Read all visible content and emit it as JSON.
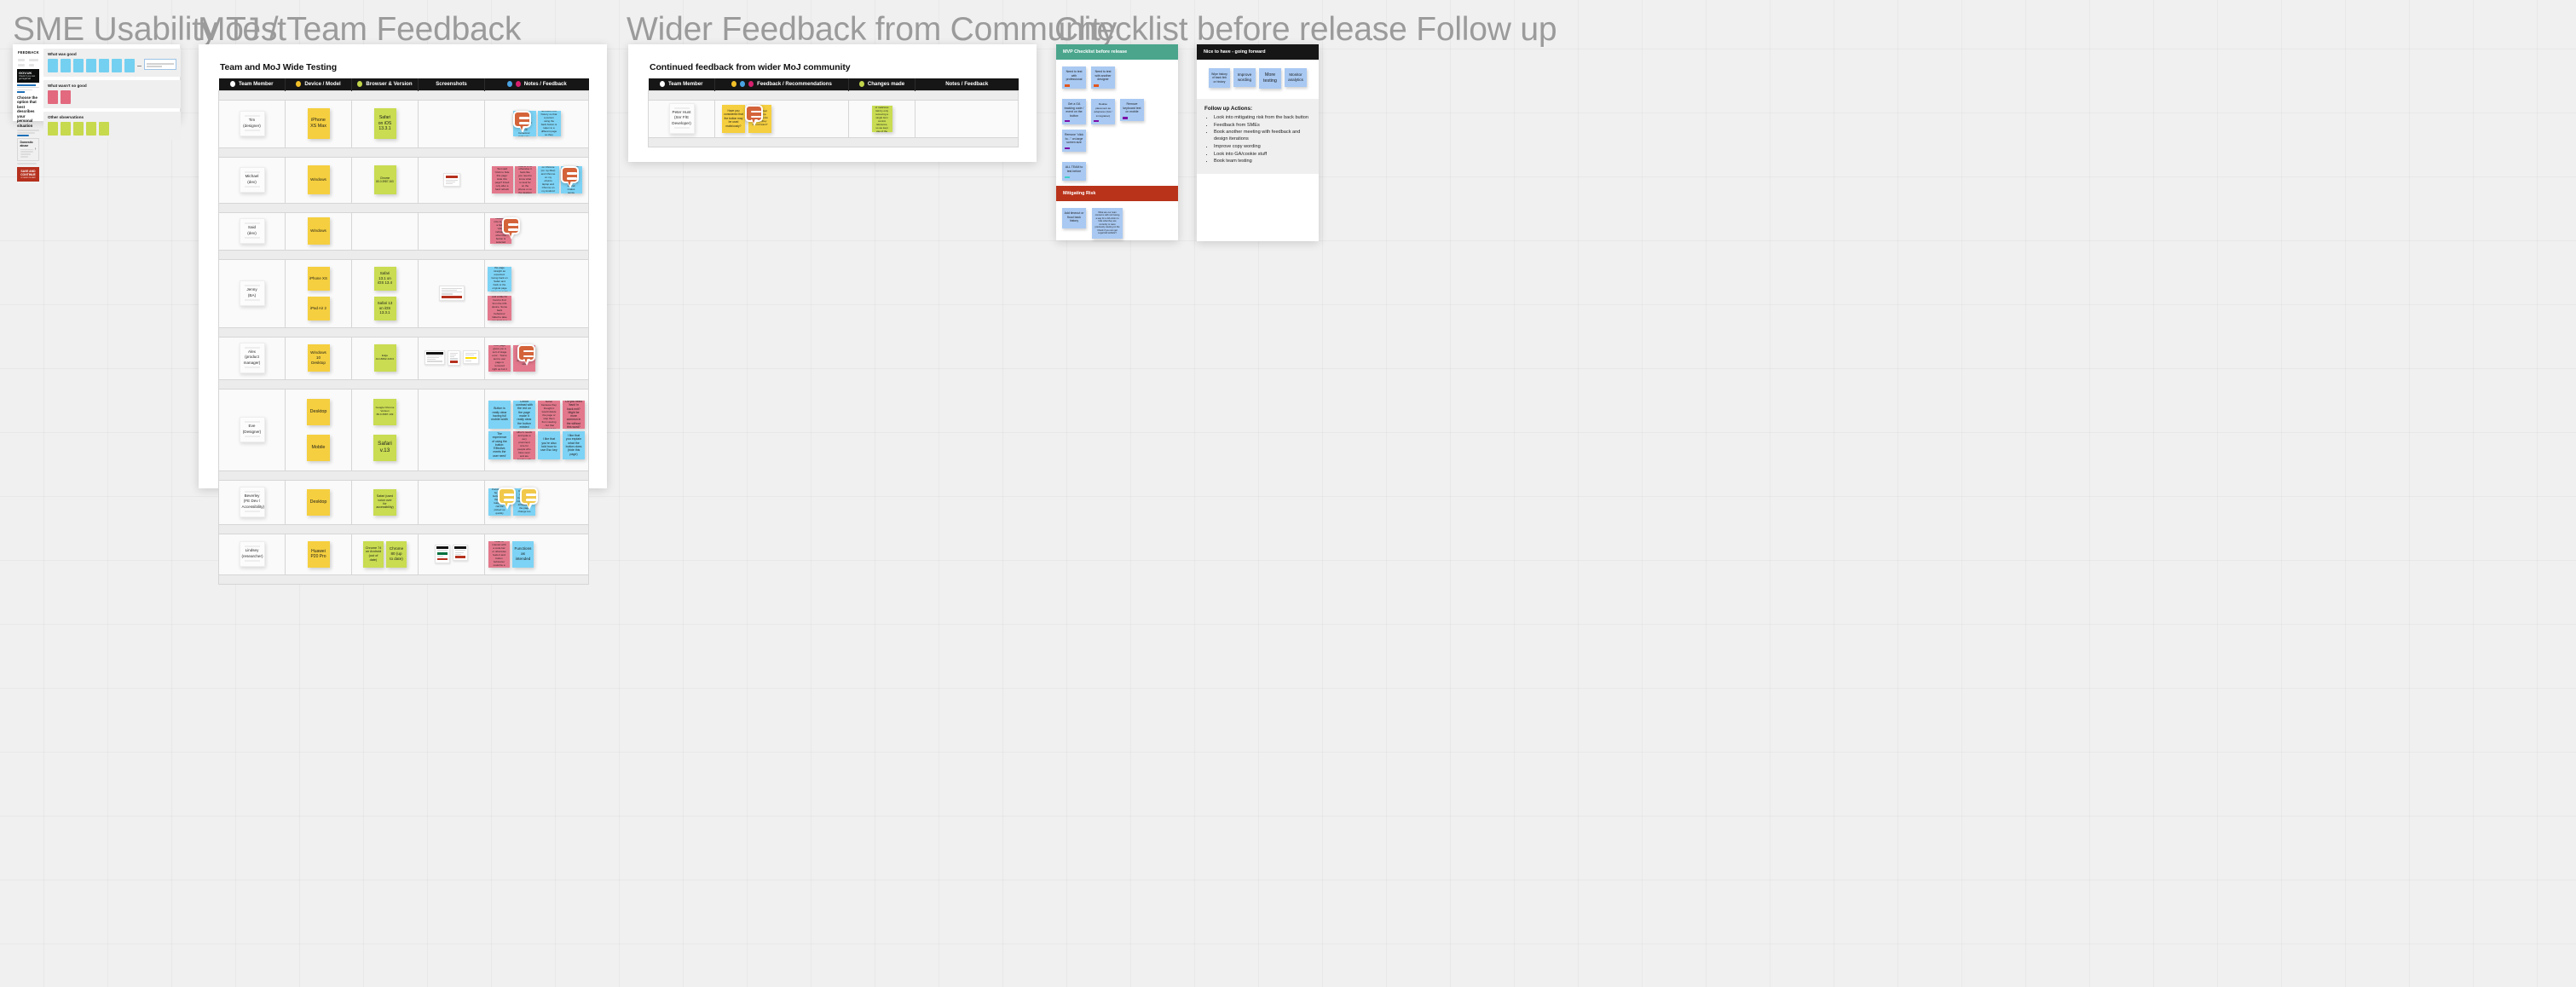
{
  "sections": [
    {
      "id": "sme",
      "title": "SME Usability Test"
    },
    {
      "id": "moj",
      "title": "MoJ / Team Feedback"
    },
    {
      "id": "wider",
      "title": "Wider Feedback from Community"
    },
    {
      "id": "checklist",
      "title": "Checklist before release Follow up"
    }
  ],
  "sme_card": {
    "gov": {
      "heading": "FEEDBACK",
      "brand": "GOV.UK",
      "brand_sub": "Check if you can get legal aid",
      "question": "Choose the option that best describes your personal situation",
      "box_title": "Domestic abuse",
      "button_label": "SAVE AND CONTINUE",
      "button_sub": "or return to start"
    },
    "groups": [
      {
        "label": "What was good",
        "color": "blue",
        "count": 7,
        "has_callout": true
      },
      {
        "label": "What wasn't so good",
        "color": "pink",
        "count": 2,
        "has_callout": false
      },
      {
        "label": "Other observations",
        "color": "lime",
        "count": 5,
        "has_callout": false
      }
    ]
  },
  "moj_card": {
    "title": "Team and MoJ Wide Testing",
    "columns": [
      {
        "label": "Team Member",
        "dots": [
          "white"
        ]
      },
      {
        "label": "Device / Model",
        "dots": [
          "amber"
        ]
      },
      {
        "label": "Browser & Version",
        "dots": [
          "lime"
        ]
      },
      {
        "label": "Screenshots",
        "dots": []
      },
      {
        "label": "Notes / Feedback",
        "dots": [
          "blue",
          "magenta"
        ]
      }
    ],
    "rows": [
      {
        "member": "Tim\n(designer)",
        "devices": [
          "iPhone\nXS Max"
        ],
        "device_size": "large",
        "browsers": [
          "Safari\non iOS\n13.3.1"
        ],
        "browser_size": "large",
        "screenshots": 0,
        "notes": [
          {
            "color": "blue",
            "text": "Interesting to hear the user was happy with the journey but unsure about the back button behaviour hiding the page"
          },
          {
            "color": "blue",
            "text": "Would be helpful if the page was being removed from history so that a person using the back button is taken to a different page so they cannot see what they were looking at"
          }
        ],
        "bubbles": 1
      },
      {
        "member": "Michael\n(dev)",
        "devices": [
          "Windows"
        ],
        "device_size": "medium",
        "browsers": [
          "Chrome\n80.0.3987.163"
        ],
        "browser_size": "small",
        "screenshots": 1,
        "notes": [
          {
            "color": "pink",
            "text": "Text said 'Click to hide this page' Hide this page? Fixed only after a hard refresh"
          },
          {
            "color": "pink",
            "text": "Not sure if users have worked out how to CTA otherwise it feels like you need to know what to look for on the phone or on the desktop in the companion too"
          },
          {
            "color": "blue",
            "text": "Worked fine on Chrome (on my Mac) and Chrome on my ubuntu laptop and Chrome on my Android phone"
          },
          {
            "color": "blue",
            "text": "Takes you to a different page but stops you from seeing the content so that makes sense"
          }
        ],
        "bubbles": 1
      },
      {
        "member": "Said\n(dev)",
        "devices": [
          "Windows"
        ],
        "device_size": "medium",
        "browsers": [],
        "browser_size": "medium",
        "screenshots": 0,
        "notes": [
          {
            "color": "pink",
            "text": "Would be nice to have a better visual indication when the button is selected"
          }
        ],
        "bubbles": 1
      },
      {
        "member": "Jenny\n(BA)",
        "devices": [
          "iPhone XS",
          "iPad Air 2"
        ],
        "device_size": "medium",
        "browsers": [
          "Safari\n13.1 on\niOS 13.4",
          "Safari 13\non iOS\n13.3.1"
        ],
        "browser_size": "medium",
        "screenshots": 1,
        "notes": [
          {
            "color": "blue",
            "text": "iPhone XS/Safari took the page straight as expected. Going back on Safari and back to the original page came up again - as expected"
          },
          {
            "color": "pink",
            "text": "iPad was loading slower and a little bit hard to find from the iOS device. Some back behaviour failed to take you back to a safer location"
          }
        ],
        "bubbles": 0
      },
      {
        "member": "Alex\n(product\nmanager)",
        "devices": [
          "Windows\n10\nDesktop"
        ],
        "device_size": "medium",
        "browsers": [
          "Edge\n44.18362.449.0"
        ],
        "browser_size": "small",
        "screenshots": 3,
        "notes": [
          {
            "color": "pink",
            "text": "Going back from page gives you a sort of stage error - 'Some text to use' page is removed right up but it redirects"
          },
          {
            "color": "pink",
            "text": "Would be great to test on the edge of the mobile size"
          }
        ],
        "bubbles": 1
      },
      {
        "member": "Eve\n(Designer)",
        "devices": [
          "Desktop",
          "Mobile"
        ],
        "device_size": "large",
        "browsers": [
          "Google Chrome\nVersion\n80.0.3987.149",
          "Safari\nv.13"
        ],
        "browser_size": "mixed",
        "screenshots": 0,
        "notes": [
          {
            "color": "blue",
            "text": "Button is really clear having full mobile width"
          },
          {
            "color": "blue",
            "text": "Colour contrast with the red on the page made it really clear the button existed"
          },
          {
            "color": "pink",
            "text": "Hesitation that users were afraid to hit the button because they thought it would delete the page or stop them from viewing - but that could just be me not being familiar with the dialogue"
          },
          {
            "color": "pink",
            "text": "Do you need 'back' in back exit? Might be more common in the without this word?"
          },
          {
            "color": "blue",
            "text": "The experience of using the button: 'Effective, meets the user need'"
          },
          {
            "color": "pink",
            "text": "In this case by needs of other's needs and quite a very prominent size for people who have seen and are familiar with the feature"
          },
          {
            "color": "blue",
            "text": "I like that you're also told how to use Esc key"
          },
          {
            "color": "blue",
            "text": "I like that you explain what the button does (hide this page)"
          }
        ],
        "bubbles": 0
      },
      {
        "member": "Beverley\n(FE Dev /\nAccessibility)",
        "devices": [
          "Desktop"
        ],
        "device_size": "large",
        "browsers": [
          "Safari (used\nvoice over\nfor\naccessibility)"
        ],
        "browser_size": "small",
        "screenshots": 0,
        "notes": [
          {
            "color": "blue",
            "text": "Focus should be on the button when the page loads so it can be picked up quickly"
          },
          {
            "color": "blue",
            "text": "Voice over read the button label correctly and announced the page change too"
          }
        ],
        "bubbles": 2,
        "bubble_color": "yellow"
      },
      {
        "member": "Lindsey\n(researcher)",
        "devices": [
          "Huawei\nP20 Pro"
        ],
        "device_size": "medium",
        "browsers": [
          "Chrome 74\non Android\n(out of\ndate)",
          "Chrome\n80 (up\nto date)"
        ],
        "browser_size": "mixed",
        "screenshots": 2,
        "notes": [
          {
            "color": "pink",
            "text": "Does still need to interact with a code bar or otherwise feels it and button behaviour could be a bit of a faff"
          },
          {
            "color": "blue",
            "text": "Functions as intended"
          }
        ],
        "bubbles": 0
      }
    ]
  },
  "wider_card": {
    "title": "Continued feedback from wider MoJ community",
    "columns": [
      {
        "label": "Team Member",
        "dots": [
          "white"
        ]
      },
      {
        "label": "Feedback / Recommendations",
        "dots": [
          "amber",
          "blue",
          "magenta"
        ]
      },
      {
        "label": "Changes made",
        "dots": [
          "lime"
        ]
      },
      {
        "label": "Notes / Feedback",
        "dots": []
      }
    ],
    "rows": [
      {
        "member": "Peter Hunt\n(Snr F/E\nDeveloper)",
        "feedback": [
          {
            "color": "amber",
            "text": "Have you considered that the button may be used maliciously?"
          },
          {
            "color": "amber",
            "text": "Could a bad actor force someone onto a page they did not want?"
          }
        ],
        "changes": [
          {
            "color": "lime",
            "text": "We lowered the amount of malicious risk by only removing a single item control reference, so we kept use of the button"
          }
        ],
        "notes": [],
        "bubbles": 1
      }
    ]
  },
  "mvp_card": {
    "head": "MVP Checklist before release",
    "items": [
      {
        "text": "Need to test with professional",
        "tag": "orange"
      },
      {
        "text": "Need to test with another designer",
        "tag": "orange"
      },
      {
        "text": "Get a GA tracking code / event on the button",
        "tag": "purple"
      },
      {
        "text": "Realise placement as adoptures (GA / immigration)",
        "tag": "purple"
      },
      {
        "text": "Remove keyboard text on mobile",
        "tag": "purple"
      },
      {
        "text": "Remove \"click to...\" on large screen size",
        "tag": "purple"
      },
      {
        "text": "ALL TEAM to test before",
        "tag": "teal"
      }
    ],
    "risk_head": "Mitigating Risk",
    "risk_items": [
      {
        "text": "Add timeout or flood back history",
        "size": "small"
      },
      {
        "text": "What are our main concerns with not having a way for a DA victim to hide what they are currently or were previously viewing on the Check if you can get Legal Aid website?",
        "size": "large"
      }
    ]
  },
  "nice_card": {
    "head": "Nice to have - going forward",
    "notes": [
      {
        "text": "Wipe history of back link or history",
        "size": "small"
      },
      {
        "text": "Improve wording",
        "size": "normal"
      },
      {
        "text": "More testing",
        "size": "normal"
      },
      {
        "text": "Monitor analytics",
        "size": "normal"
      }
    ],
    "follow_up": {
      "title": "Follow up Actions:",
      "items": [
        "Look into mitigating risk from the back button",
        "Feedback from SMEs",
        "Book another meeting with feedback and design iterations",
        "Improve copy wording",
        "Look into GA/cookie stuff",
        "Book team testing"
      ]
    }
  },
  "colors": {
    "canvas": "#f0f0f0",
    "title": "#9b9b9b",
    "header_black": "#161616",
    "green": "#4aa58c",
    "red": "#b9331b",
    "sticky_amber": "#f5cf3f",
    "sticky_lime": "#c9dc52",
    "sticky_blue": "#7dd3f5",
    "sticky_pink": "#e3788c",
    "sticky_lightblue": "#a9c9f2",
    "bubble": "#d4633a"
  }
}
